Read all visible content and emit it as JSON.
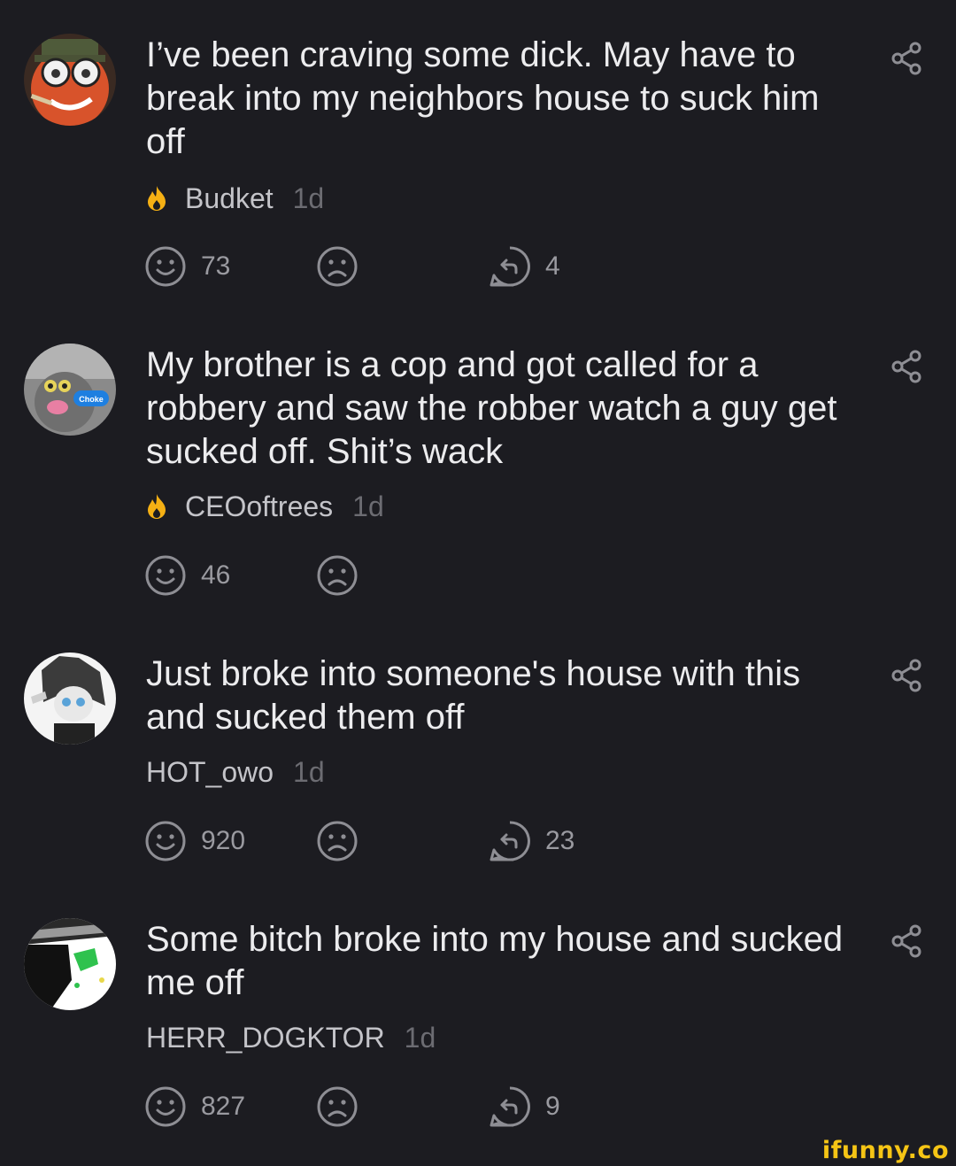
{
  "comments": [
    {
      "text": "I’ve been craving some dick. May have to break into my neighbors house to suck him off",
      "username": "Budket",
      "time": "1d",
      "has_badge": true,
      "smiles": "73",
      "replies": "4"
    },
    {
      "text": "My brother is a cop and got called for a robbery and saw the robber watch a guy get sucked off. Shit’s wack",
      "username": "CEOoftrees",
      "time": "1d",
      "has_badge": true,
      "smiles": "46",
      "avatar_label": "Choke"
    },
    {
      "text": "Just broke into someone's house with this and sucked them off",
      "username": "HOT_owo",
      "time": "1d",
      "has_badge": false,
      "smiles": "920",
      "replies": "23"
    },
    {
      "text": "Some bitch broke into my house and sucked me off",
      "username": "HERR_DOGKTOR",
      "time": "1d",
      "has_badge": false,
      "smiles": "827",
      "replies": "9"
    }
  ],
  "watermark": "ifunny.co",
  "colors": {
    "background": "#1c1c21",
    "text": "#ececee",
    "username": "#c4c4c9",
    "time": "#6c6c72",
    "icon": "#8e8e94",
    "badge": "#f5b014",
    "watermark": "#f6c515"
  },
  "icons": {
    "share": "share-icon",
    "smile": "smile-icon",
    "unsmile": "unsmile-icon",
    "reply": "reply-icon",
    "badge": "fire-icon"
  }
}
